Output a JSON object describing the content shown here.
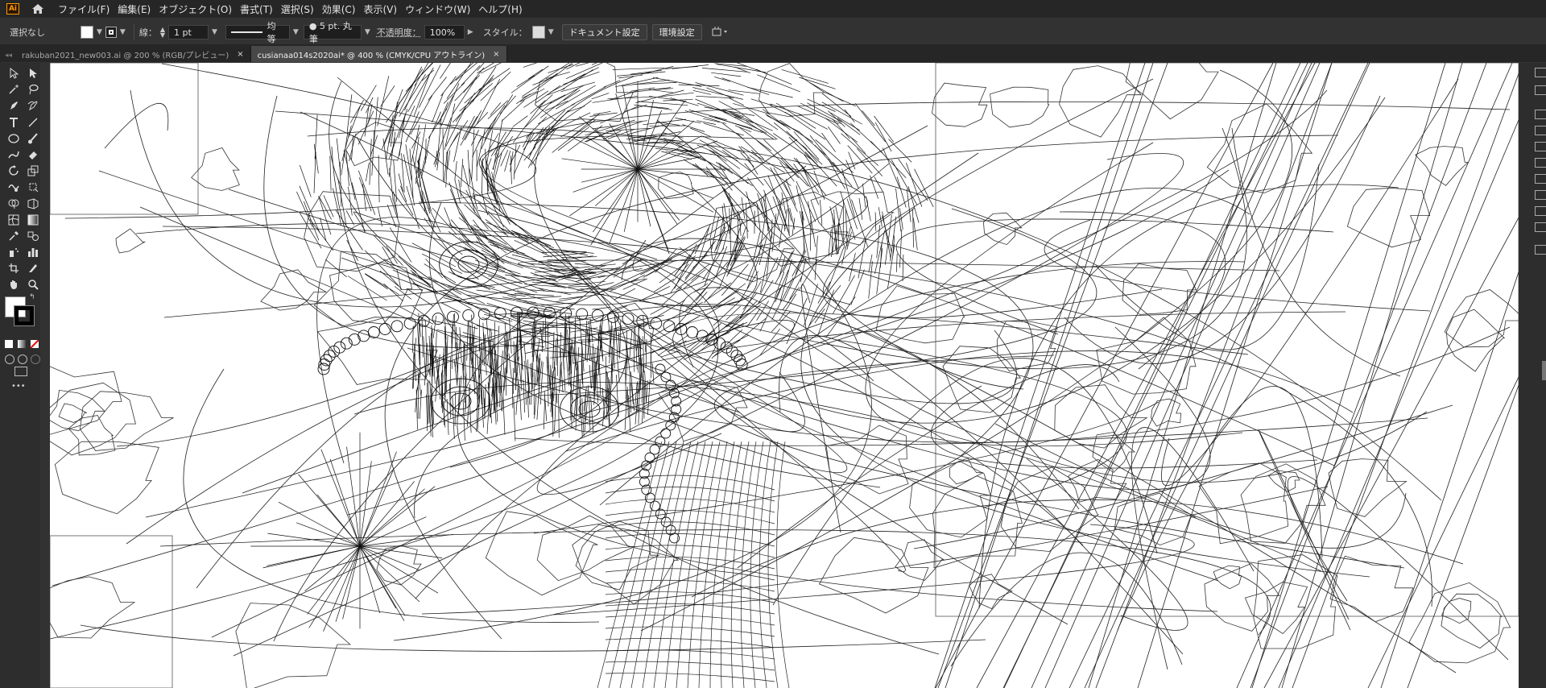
{
  "app": {
    "logo": "Ai",
    "menus": [
      "ファイル(F)",
      "編集(E)",
      "オブジェクト(O)",
      "書式(T)",
      "選択(S)",
      "効果(C)",
      "表示(V)",
      "ウィンドウ(W)",
      "ヘルプ(H)"
    ]
  },
  "control": {
    "selection": "選択なし",
    "stroke_label": "線：",
    "stroke_weight": "1 pt",
    "profile": "均等",
    "brush": "● 5 pt. 丸筆",
    "opacity_label": "不透明度：",
    "opacity_value": "100%",
    "style_label": "スタイル：",
    "doc_setup": "ドキュメント設定",
    "prefs": "環境設定"
  },
  "tabs": [
    {
      "label": "rakuban2021_new003.ai @ 200 % (RGB/プレビュー)",
      "close": "×",
      "active": false
    },
    {
      "label": "cusianaa014s2020ai* @ 400 % (CMYK/CPU アウトライン)",
      "close": "×",
      "active": true
    }
  ],
  "toolbar": {
    "more": "•••"
  },
  "colors": {
    "accent": "#ff9a00",
    "canvas": "#ffffff",
    "chrome": "#323232"
  },
  "icons": [
    "home-icon",
    "selection-tool-icon",
    "direct-selection-tool-icon",
    "magic-wand-icon",
    "lasso-icon",
    "pen-icon",
    "curvature-icon",
    "type-icon",
    "line-icon",
    "ellipse-icon",
    "paintbrush-icon",
    "shaper-icon",
    "eraser-icon",
    "rotate-icon",
    "scale-icon",
    "warp-icon",
    "free-transform-icon",
    "shape-builder-icon",
    "perspective-icon",
    "mesh-icon",
    "gradient-icon",
    "eyedropper-icon",
    "blend-icon",
    "symbol-sprayer-icon",
    "column-graph-icon",
    "artboard-icon",
    "slice-icon",
    "hand-icon",
    "zoom-icon"
  ]
}
